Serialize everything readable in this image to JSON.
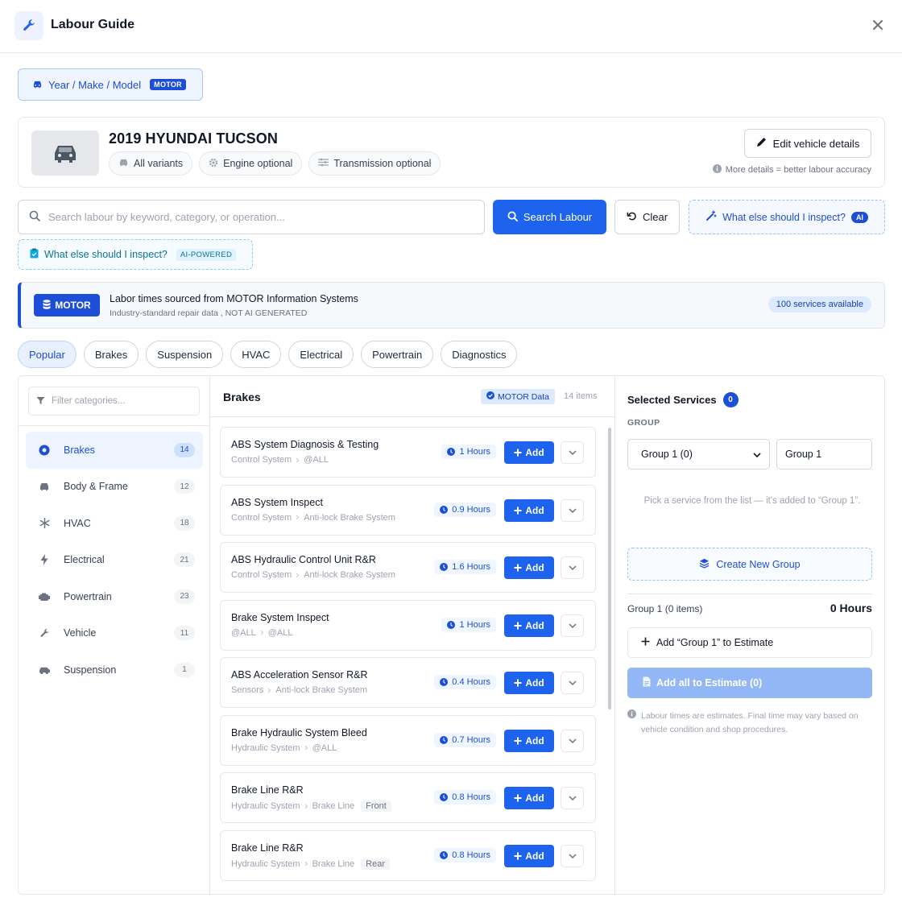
{
  "header": {
    "title": "Labour Guide"
  },
  "ymm": {
    "label": "Year / Make / Model",
    "badge": "MOTOR"
  },
  "vehicle": {
    "title": "2019 HYUNDAI TUCSON",
    "chips": [
      "All variants",
      "Engine optional",
      "Transmission optional"
    ],
    "edit_label": "Edit vehicle details",
    "hint": "More details = better labour accuracy"
  },
  "search": {
    "placeholder": "Search labour by keyword, category, or operation...",
    "button": "Search Labour",
    "clear": "Clear",
    "inspect": "What else should I inspect?",
    "inspect_badge": "AI",
    "inspect2": "What else should I inspect?",
    "inspect2_badge": "AI-POWERED"
  },
  "banner": {
    "logo": "MOTOR",
    "title": "Labor times sourced from MOTOR Information Systems",
    "subtitle": "Industry-standard repair data , NOT AI GENERATED",
    "available": "100 services available"
  },
  "tabs": [
    "Popular",
    "Brakes",
    "Suspension",
    "HVAC",
    "Electrical",
    "Powertrain",
    "Diagnostics"
  ],
  "categories": {
    "filter_placeholder": "Filter categories...",
    "items": [
      {
        "label": "Brakes",
        "count": "14",
        "icon": "brake-disc-icon"
      },
      {
        "label": "Body & Frame",
        "count": "12",
        "icon": "car-icon"
      },
      {
        "label": "HVAC",
        "count": "18",
        "icon": "snowflake-icon"
      },
      {
        "label": "Electrical",
        "count": "21",
        "icon": "bolt-icon"
      },
      {
        "label": "Powertrain",
        "count": "23",
        "icon": "engine-icon"
      },
      {
        "label": "Vehicle",
        "count": "11",
        "icon": "wrench-icon"
      },
      {
        "label": "Suspension",
        "count": "1",
        "icon": "car-side-icon"
      }
    ]
  },
  "services": {
    "title": "Brakes",
    "motor_data": "MOTOR Data",
    "count": "14 items",
    "add_label": "Add",
    "items": [
      {
        "name": "ABS System Diagnosis & Testing",
        "path": [
          "Control System",
          "@ALL"
        ],
        "tag": "",
        "hours": "1 Hours"
      },
      {
        "name": "ABS System Inspect",
        "path": [
          "Control System",
          "Anti-lock Brake System"
        ],
        "tag": "",
        "hours": "0.9 Hours"
      },
      {
        "name": "ABS Hydraulic Control Unit R&R",
        "path": [
          "Control System",
          "Anti-lock Brake System"
        ],
        "tag": "",
        "hours": "1.6 Hours"
      },
      {
        "name": "Brake System Inspect",
        "path": [
          "@ALL",
          "@ALL"
        ],
        "tag": "",
        "hours": "1 Hours"
      },
      {
        "name": "ABS Acceleration Sensor R&R",
        "path": [
          "Sensors",
          "Anti-lock Brake System"
        ],
        "tag": "",
        "hours": "0.4 Hours"
      },
      {
        "name": "Brake Hydraulic System Bleed",
        "path": [
          "Hydraulic System",
          "@ALL"
        ],
        "tag": "",
        "hours": "0.7 Hours"
      },
      {
        "name": "Brake Line R&R",
        "path": [
          "Hydraulic System",
          "Brake Line"
        ],
        "tag": "Front",
        "hours": "0.8 Hours"
      },
      {
        "name": "Brake Line R&R",
        "path": [
          "Hydraulic System",
          "Brake Line"
        ],
        "tag": "Rear",
        "hours": "0.8 Hours"
      }
    ]
  },
  "selected": {
    "title": "Selected Services",
    "count": "0",
    "group_label": "GROUP",
    "group_select": "Group 1 (0)",
    "group_name": "Group 1",
    "hint": "Pick a service from the list — it's added to “Group 1”.",
    "new_group": "Create New Group",
    "group_items": "Group 1 (0 items)",
    "group_hours": "0 Hours",
    "add_group": "Add “Group 1” to Estimate",
    "add_all": "Add all to Estimate (0)",
    "disclaimer": "Labour times are estimates. Final time may vary based on vehicle condition and shop procedures."
  },
  "colors": {
    "accent": "#1d63ed",
    "brand": "#1d4ed8"
  }
}
